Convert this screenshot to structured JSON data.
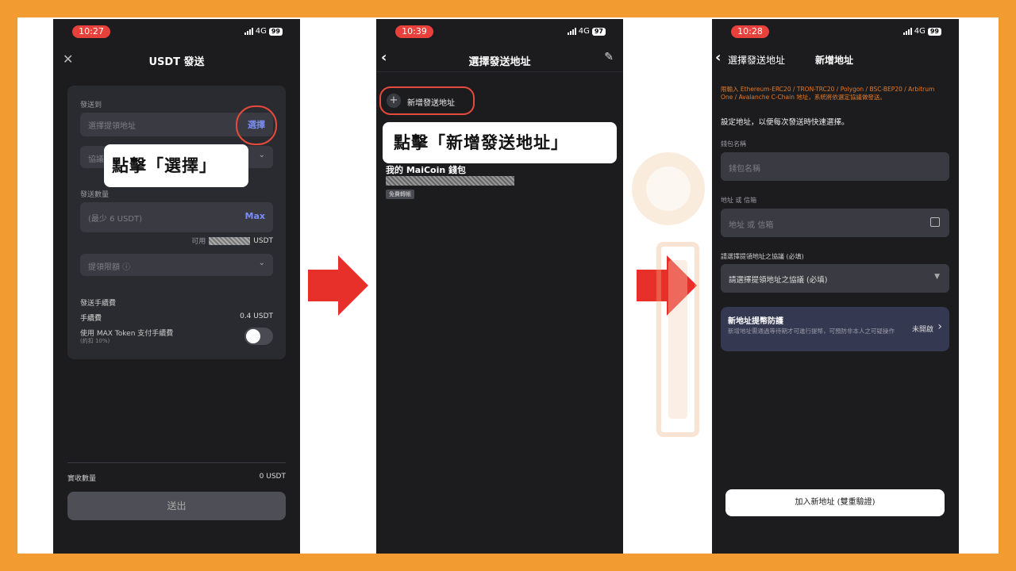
{
  "screen1": {
    "time": "10:27",
    "network": "4G",
    "battery": "99",
    "title": "USDT 發送",
    "send_to_label": "發送到",
    "address_placeholder": "選擇提領地址",
    "select_label": "選擇",
    "network_placeholder": "協議",
    "amount_label": "發送數量",
    "amount_placeholder": "(最少 6 USDT)",
    "max_label": "Max",
    "available_prefix": "可用",
    "available_unit": "USDT",
    "limit_label": "提領限額 ⓘ",
    "fee_section": "發送手續費",
    "fee_label": "手續費",
    "fee_value": "0.4 USDT",
    "max_token_line1": "使用 MAX Token 支付手續費",
    "max_token_line2": "(約扣 10%)",
    "receive_label": "實收數量",
    "receive_value": "0 USDT",
    "send_button": "送出",
    "callout": "點擊「選擇」"
  },
  "screen2": {
    "time": "10:39",
    "network": "4G",
    "battery": "97",
    "title": "選擇發送地址",
    "add_label": "新增發送地址",
    "wallet_name": "我的 MaiCoin 錢包",
    "free_badge": "免費轉帳",
    "callout": "點擊「新增發送地址」"
  },
  "screen3": {
    "time": "10:28",
    "network": "4G",
    "battery": "99",
    "back_label": "選擇發送地址",
    "title": "新增地址",
    "warning": "限輸入 Ethereum-ERC20 / TRON-TRC20 / Polygon / BSC-BEP20 / Arbitrum One / Avalanche C-Chain 地址，系統將依選定協議做發送。",
    "desc": "設定地址，以便每次發送時快速選擇。",
    "wallet_name_label": "錢包名稱",
    "wallet_name_placeholder": "錢包名稱",
    "address_label": "地址 或 信箱",
    "address_placeholder": "地址 或 信箱",
    "protocol_label": "請選擇提領地址之協議 (必填)",
    "protocol_placeholder": "請選擇提領地址之協議 (必填)",
    "protect_title": "新地址提幣防護",
    "protect_desc": "新增地址需通過等待期才可進行提幣，可預防非本人之可疑操作",
    "protect_status": "未開啟",
    "submit_button": "加入新地址 (雙重驗證)"
  },
  "colors": {
    "frame": "#f29b30",
    "highlight": "#e64a3b",
    "accent": "#7b8cf7",
    "warning": "#e07a2b"
  }
}
